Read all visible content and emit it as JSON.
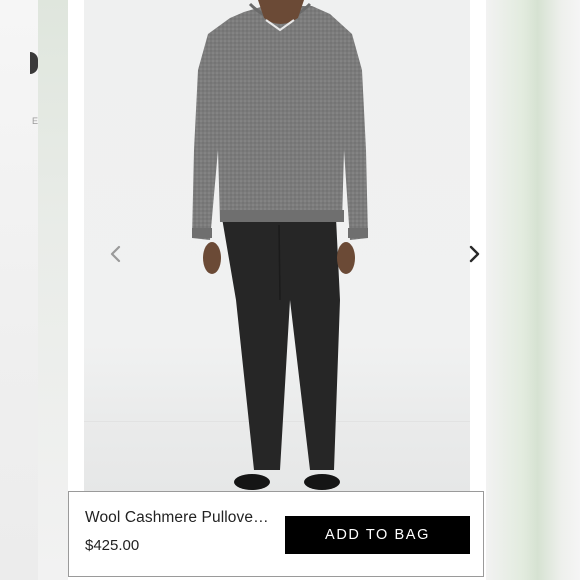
{
  "carousel": {
    "prev_icon": "chevron-left-icon",
    "next_icon": "chevron-right-icon"
  },
  "product": {
    "name": "Wool Cashmere Pullove…",
    "price": "$425.00",
    "add_to_bag_label": "ADD TO BAG"
  },
  "background": {
    "left_fragment_letter": "E"
  },
  "colors": {
    "button_bg": "#000000",
    "button_text": "#ffffff",
    "sweater": "#7a7a7a",
    "pants": "#2a2a2a"
  }
}
